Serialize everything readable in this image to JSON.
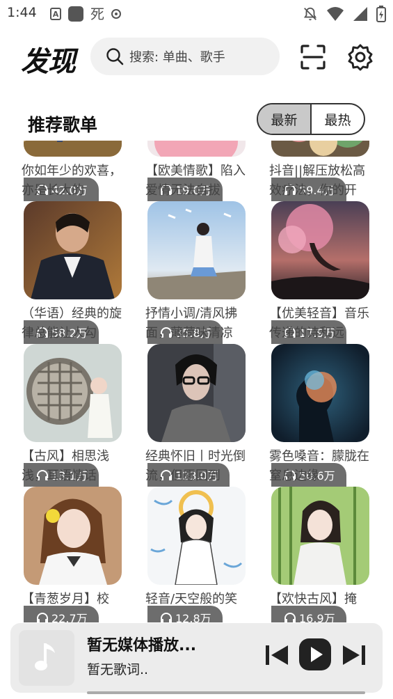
{
  "status_bar": {
    "time": "1:44",
    "a_badge": "A"
  },
  "header": {
    "title": "发现",
    "search_placeholder": "搜索: 单曲、歌手",
    "icons": [
      "search-icon",
      "scan-icon",
      "gear-icon"
    ]
  },
  "section": {
    "title": "推荐歌单",
    "toggle": {
      "options": [
        "最新",
        "最热"
      ],
      "selected": "最新"
    }
  },
  "playlists": [
    {
      "plays": "42.0万",
      "title": "你如年少的欢喜，亦是长大的"
    },
    {
      "plays": "19.0万",
      "title": "【欧美情歌】陷入爱情无法自拔"
    },
    {
      "plays": "59.4万",
      "title": "抖音||解压放松高效疗法，你的开"
    },
    {
      "plays": "58.2万",
      "title": "（华语）经典的旋律总能让人勾"
    },
    {
      "plays": "35.8万",
      "title": "抒情小调/清风拂面，薄荷味清凉"
    },
    {
      "plays": "17.9万",
      "title": "【优美轻音】音乐传递的诗和远"
    },
    {
      "plays": "13.1万",
      "title": "【古风】相思浅浅，耳语情话"
    },
    {
      "plays": "123.0万",
      "title": "经典怀旧丨时光倒流，但愿回到"
    },
    {
      "plays": "50.6万",
      "title": "雾色嗓音：朦胧在窒息边缘"
    },
    {
      "plays": "22.7万",
      "title": "【青葱岁月】校"
    },
    {
      "plays": "12.8万",
      "title": "轻音/天空般的笑"
    },
    {
      "plays": "16.9万",
      "title": "【欢快古风】掩"
    }
  ],
  "player": {
    "title": "暂无媒体播放...",
    "subtitle": "暂无歌词..",
    "progress": 0
  }
}
